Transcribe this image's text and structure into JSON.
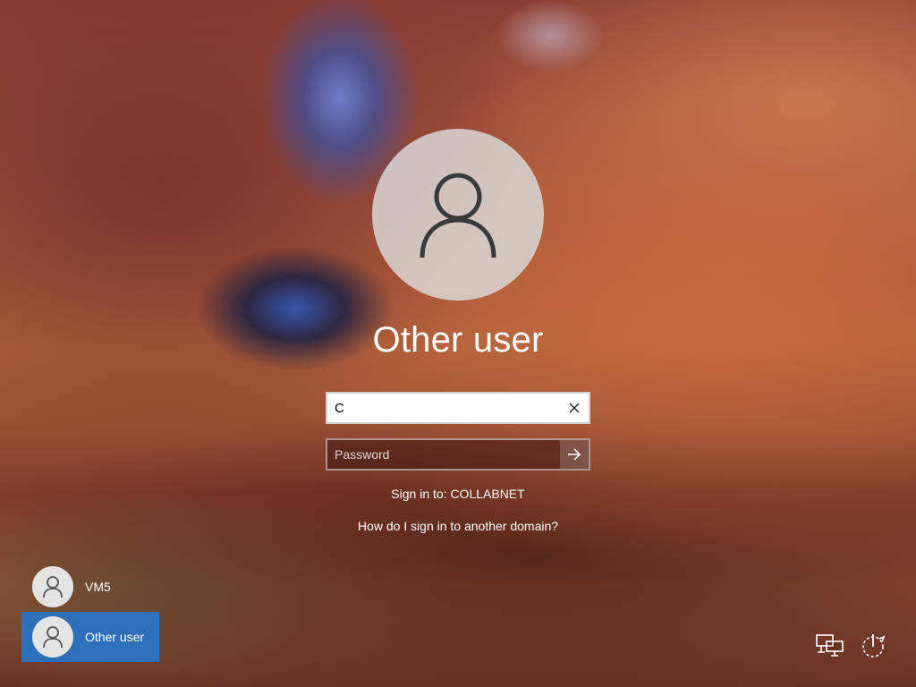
{
  "login": {
    "user_name": "Other user",
    "username_value": "C",
    "password_placeholder": "Password",
    "sign_in_to": "Sign in to: COLLABNET",
    "domain_help_link": "How do I sign in to another domain?"
  },
  "user_list": [
    {
      "label": "VM5",
      "selected": false
    },
    {
      "label": "Other user",
      "selected": true
    }
  ],
  "corner_icons": {
    "network": "network-icon",
    "power": "power-icon"
  },
  "colors": {
    "selected_tile": "#2d6fb8",
    "avatar_bg": "#dcdcdc",
    "text": "#ffffff"
  }
}
